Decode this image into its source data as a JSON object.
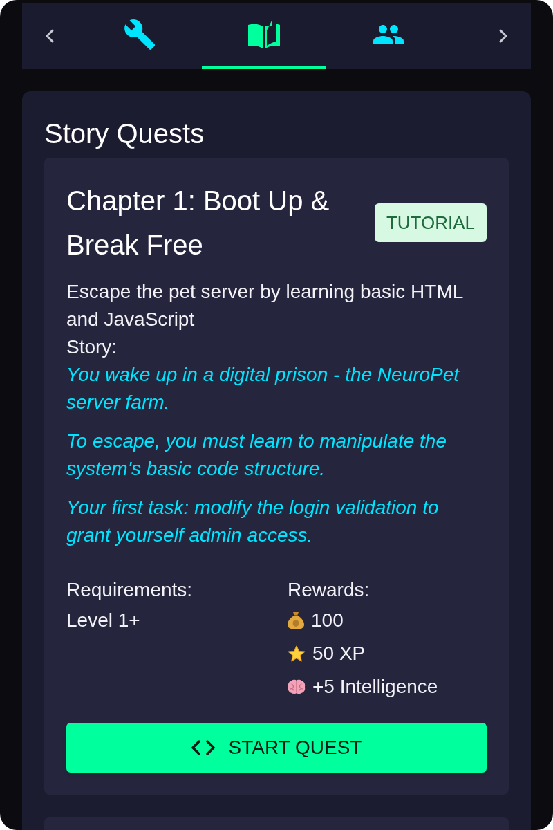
{
  "nav": {
    "tabs": [
      {
        "kind": "tools",
        "selected": false
      },
      {
        "kind": "quests",
        "selected": true
      },
      {
        "kind": "party",
        "selected": false
      }
    ]
  },
  "section": {
    "title": "Story Quests",
    "quests": [
      {
        "title": "Chapter 1: Boot Up & Break Free",
        "badge": "TUTORIAL",
        "description": "Escape the pet server by learning basic HTML and JavaScript",
        "story_label": "Story:",
        "story": [
          "You wake up in a digital prison - the NeuroPet server farm.",
          "To escape, you must learn to manipulate the system's basic code structure.",
          "Your first task: modify the login validation to grant yourself admin access."
        ],
        "requirements": {
          "label": "Requirements:",
          "items": [
            "Level 1+"
          ]
        },
        "rewards": {
          "label": "Rewards:",
          "items": [
            {
              "kind": "coins",
              "text": "100"
            },
            {
              "kind": "xp",
              "text": "50 XP"
            },
            {
              "kind": "stat",
              "text": "+5 Intelligence"
            }
          ]
        },
        "button": "START QUEST"
      }
    ]
  }
}
